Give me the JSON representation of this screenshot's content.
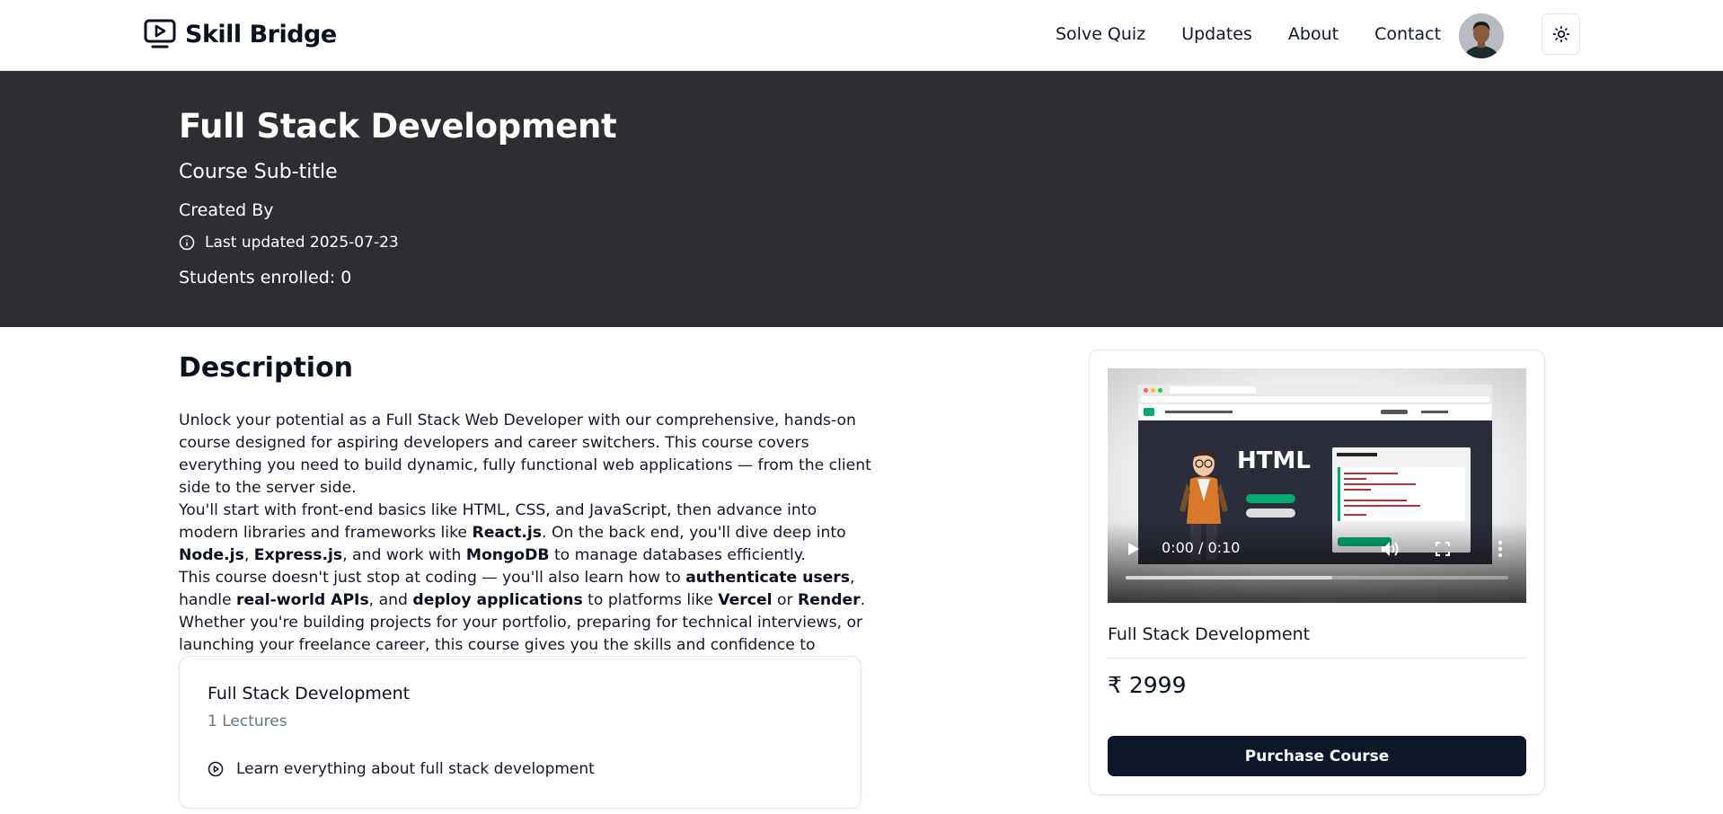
{
  "nav": {
    "brand": "Skill Bridge",
    "links": [
      "Solve Quiz",
      "Updates",
      "About",
      "Contact"
    ]
  },
  "hero": {
    "title": "Full Stack Development",
    "subtitle": "Course Sub-title",
    "created_by": "Created By",
    "last_updated": "Last updated 2025-07-23",
    "enrolled": "Students enrolled: 0"
  },
  "description": {
    "heading": "Description",
    "p1": "Unlock your potential as a Full Stack Web Developer with our comprehensive, hands-on course designed for aspiring developers and career switchers. This course covers everything you need to build dynamic, fully functional web applications — from the client side to the server side.",
    "p2_a": "You'll start with front-end basics like HTML, CSS, and JavaScript, then advance into modern libraries and frameworks like ",
    "p2_b1": "React.js",
    "p2_c": ". On the back end, you'll dive deep into ",
    "p2_b2": "Node.js",
    "p2_d": ", ",
    "p2_b3": "Express.js",
    "p2_e": ", and work with ",
    "p2_b4": "MongoDB",
    "p2_f": " to manage databases efficiently.",
    "p3_a": "This course doesn't just stop at coding — you'll also learn how to ",
    "p3_b1": "authenticate users",
    "p3_c": ", handle ",
    "p3_b2": "real-world APIs",
    "p3_d": ", and ",
    "p3_b3": "deploy applications",
    "p3_e": " to platforms like ",
    "p3_b4": "Vercel",
    "p3_f": " or ",
    "p3_b5": "Render",
    "p3_g": ". Whether you're building projects for your portfolio, preparing for technical interviews, or launching your freelance career, this course gives you the skills and confidence to succeed in today's tech-driven world."
  },
  "curriculum": {
    "title": "Full Stack Development",
    "count": "1 Lectures",
    "lecture": "Learn everything about full stack development"
  },
  "sidecard": {
    "video": {
      "time": "0:00 / 0:10",
      "progress_buffered": 0.54,
      "thumb_heading": "HTML"
    },
    "title": "Full Stack Development",
    "price": "₹ 2999",
    "purchase": "Purchase Course"
  },
  "colors": {
    "hero_bg": "#2d2e31",
    "button_bg": "#0f172a",
    "muted_text": "#64748b"
  },
  "icons": [
    "tv-play-icon",
    "sun-icon",
    "info-icon",
    "play-circle-icon",
    "play-icon",
    "volume-icon",
    "fullscreen-icon",
    "more-vert-icon"
  ]
}
